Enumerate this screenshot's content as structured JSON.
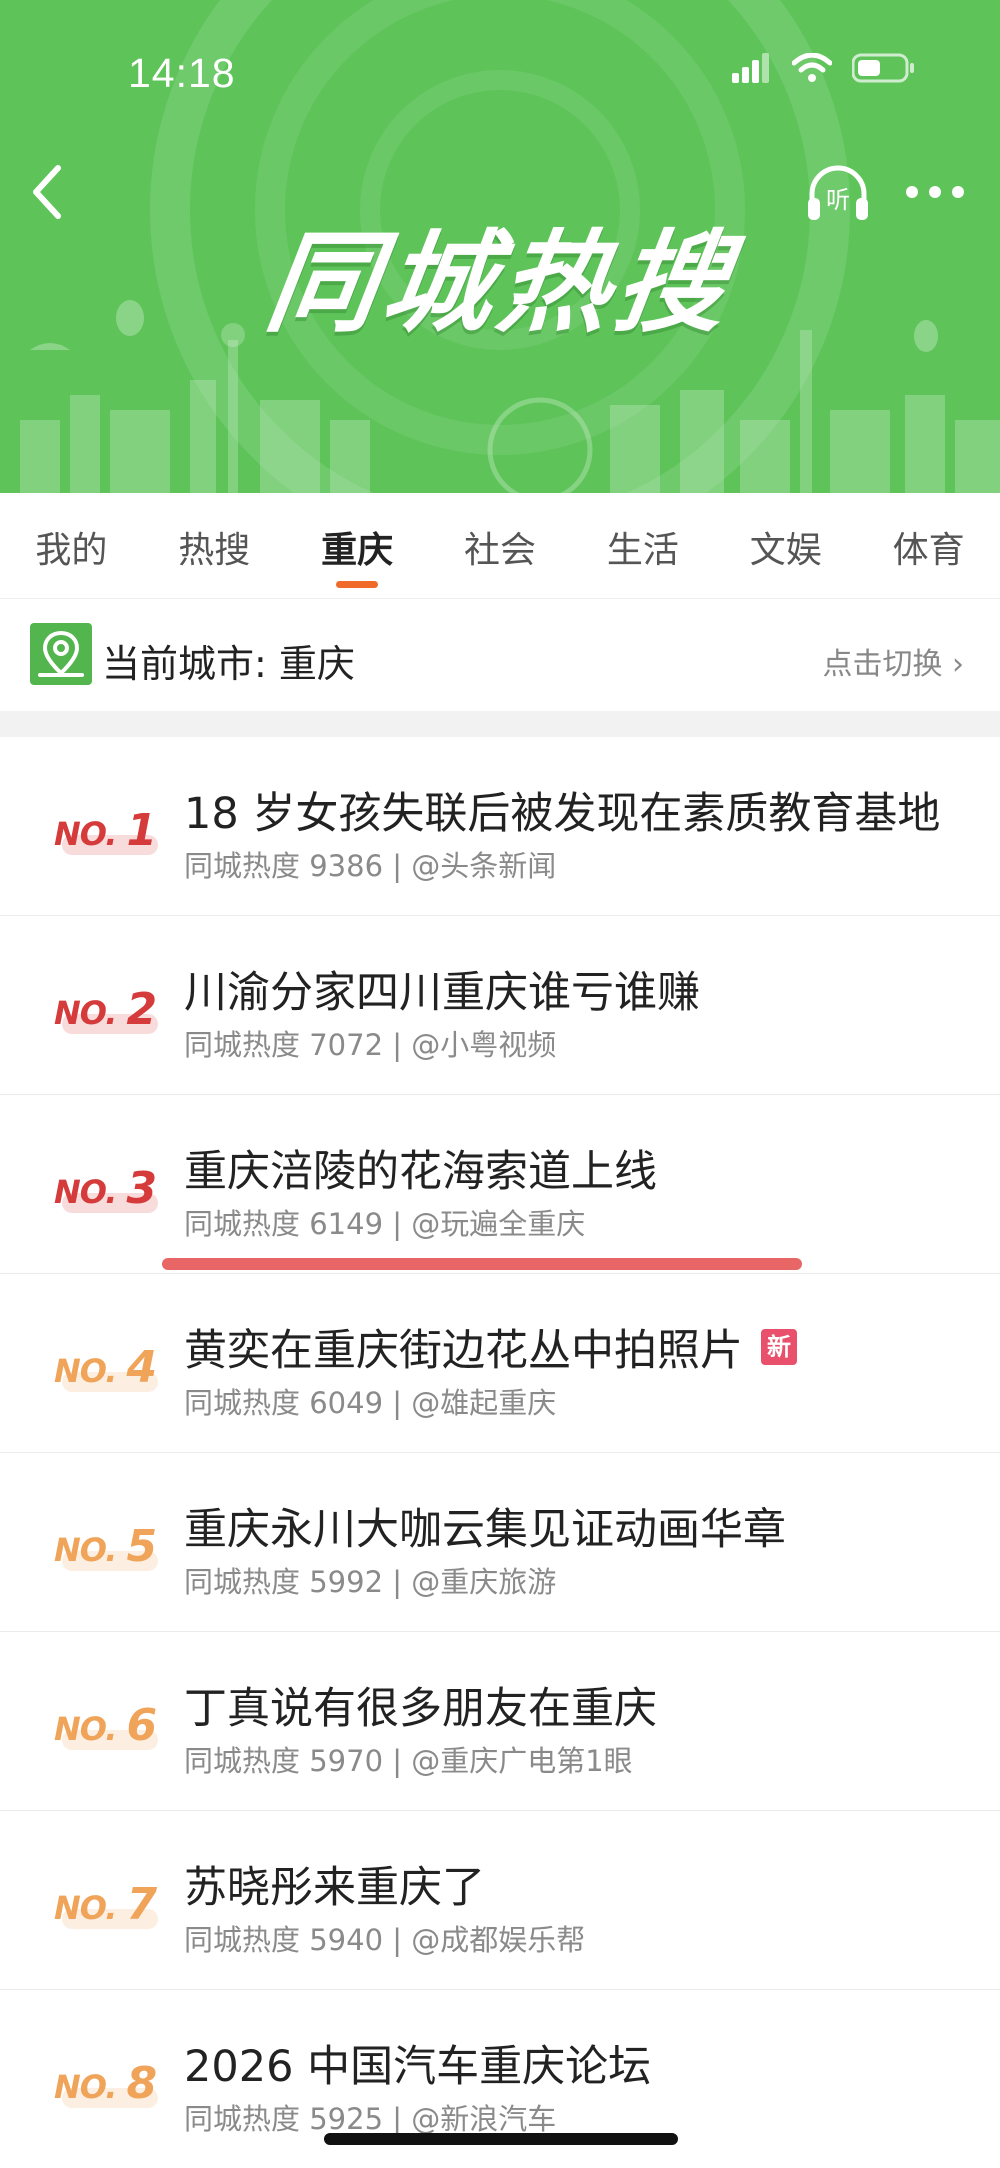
{
  "status_bar": {
    "time": "14:18"
  },
  "header": {
    "title": "同城热搜",
    "listen_icon_label": "听"
  },
  "tabs": [
    {
      "label": "我的",
      "active": false
    },
    {
      "label": "热搜",
      "active": false
    },
    {
      "label": "重庆",
      "active": true
    },
    {
      "label": "社会",
      "active": false
    },
    {
      "label": "生活",
      "active": false
    },
    {
      "label": "文娱",
      "active": false
    },
    {
      "label": "体育",
      "active": false
    }
  ],
  "city": {
    "label": "当前城市: 重庆",
    "switch_label": "点击切换 ›"
  },
  "items": [
    {
      "no": "NO.",
      "rank": "1",
      "title": "18 岁女孩失联后被发现在素质教育基地",
      "meta": "同城热度 9386 | @头条新闻",
      "color": "#d63b3b",
      "badge": ""
    },
    {
      "no": "NO.",
      "rank": "2",
      "title": "川渝分家四川重庆谁亏谁赚",
      "meta": "同城热度 7072 | @小粤视频",
      "color": "#d63b3b",
      "badge": ""
    },
    {
      "no": "NO.",
      "rank": "3",
      "title": "重庆涪陵的花海索道上线",
      "meta": "同城热度 6149 | @玩遍全重庆",
      "color": "#d63b3b",
      "badge": ""
    },
    {
      "no": "NO.",
      "rank": "4",
      "title": "黄奕在重庆街边花丛中拍照片",
      "meta": "同城热度 6049 | @雄起重庆",
      "color": "#f0a45a",
      "badge": "新"
    },
    {
      "no": "NO.",
      "rank": "5",
      "title": "重庆永川大咖云集见证动画华章",
      "meta": "同城热度 5992 | @重庆旅游",
      "color": "#f0a45a",
      "badge": ""
    },
    {
      "no": "NO.",
      "rank": "6",
      "title": "丁真说有很多朋友在重庆",
      "meta": "同城热度 5970 | @重庆广电第1眼",
      "color": "#f0a45a",
      "badge": ""
    },
    {
      "no": "NO.",
      "rank": "7",
      "title": "苏晓彤来重庆了",
      "meta": "同城热度 5940 | @成都娱乐帮",
      "color": "#f0a45a",
      "badge": ""
    },
    {
      "no": "NO.",
      "rank": "8",
      "title": "2026 中国汽车重庆论坛",
      "meta": "同城热度 5925 | @新浪汽车",
      "color": "#f0a45a",
      "badge": ""
    }
  ],
  "colors": {
    "header_green": "#5ec45a",
    "tab_indicator": "#f06a2a",
    "badge_new": "#e8506b"
  }
}
